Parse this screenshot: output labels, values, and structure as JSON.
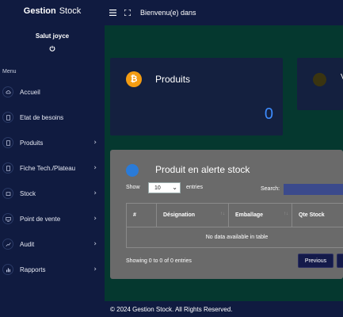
{
  "brand": {
    "bold": "Gestion",
    "rest": "Stock"
  },
  "user": {
    "greeting": "Salut joyce"
  },
  "sidebar": {
    "menu_title": "Menu",
    "items": [
      {
        "label": "Accueil",
        "icon": "cloud-icon",
        "has_submenu": false
      },
      {
        "label": "Etat de besoins",
        "icon": "document-icon",
        "has_submenu": false
      },
      {
        "label": "Produits",
        "icon": "document-icon",
        "has_submenu": true
      },
      {
        "label": "Fiche Tech./Plateau",
        "icon": "document-icon",
        "has_submenu": true
      },
      {
        "label": "Stock",
        "icon": "box-icon",
        "has_submenu": true
      },
      {
        "label": "Point de vente",
        "icon": "screen-icon",
        "has_submenu": true
      },
      {
        "label": "Audit",
        "icon": "chart-line-icon",
        "has_submenu": true
      },
      {
        "label": "Rapports",
        "icon": "bar-chart-icon",
        "has_submenu": true
      }
    ]
  },
  "topbar": {
    "welcome": "Bienvenu(e) dans"
  },
  "cards": {
    "products": {
      "title": "Produits",
      "value": "0",
      "icon": "bitcoin-icon"
    },
    "right": {
      "title_fragment": "V",
      "icon": "coin-icon"
    }
  },
  "alert": {
    "title": "Produit en alerte stock",
    "show_label": "Show",
    "entries_value": "10",
    "entries_label": "entries",
    "search_label": "Search:",
    "columns": [
      "#",
      "Désignation",
      "Emballage",
      "Qte Stock"
    ],
    "empty_text": "No data available in table",
    "info": "Showing 0 to 0 of 0 entries",
    "previous": "Previous"
  },
  "footer": {
    "text": "© 2024 Gestion Stock. All Rights Reserved."
  },
  "colors": {
    "sidebar": "#101b40",
    "main": "#05382f",
    "accent": "#3d8bfd",
    "bitcoin": "#f39c12"
  }
}
